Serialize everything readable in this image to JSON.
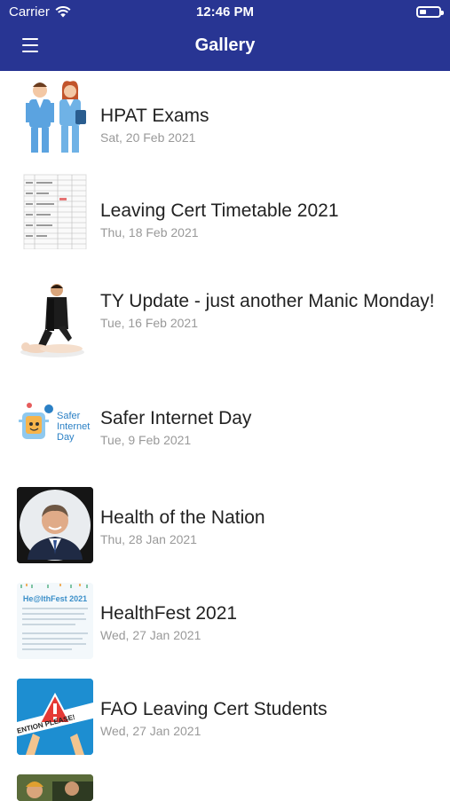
{
  "status_bar": {
    "carrier": "Carrier",
    "time": "12:46 PM"
  },
  "header": {
    "title": "Gallery",
    "menu_icon": "hamburger-menu-icon"
  },
  "colors": {
    "header_bg": "#283593",
    "title_text": "#222222",
    "date_text": "#999999"
  },
  "items": [
    {
      "title": "HPAT Exams",
      "date": "Sat, 20 Feb 2021"
    },
    {
      "title": "Leaving Cert Timetable 2021",
      "date": "Thu, 18 Feb 2021"
    },
    {
      "title": "TY Update - just another Manic Monday!",
      "date": "Tue, 16 Feb 2021"
    },
    {
      "title": "Safer Internet Day",
      "date": "Tue, 9 Feb 2021",
      "thumb_text": "Safer Internet Day"
    },
    {
      "title": "Health of the Nation",
      "date": "Thu, 28 Jan 2021"
    },
    {
      "title": "HealthFest 2021",
      "date": "Wed, 27 Jan 2021",
      "thumb_text": "He@lthFest 2021"
    },
    {
      "title": "FAO Leaving Cert Students",
      "date": "Wed, 27 Jan 2021",
      "thumb_text": "TENTION PLEASE!"
    }
  ]
}
